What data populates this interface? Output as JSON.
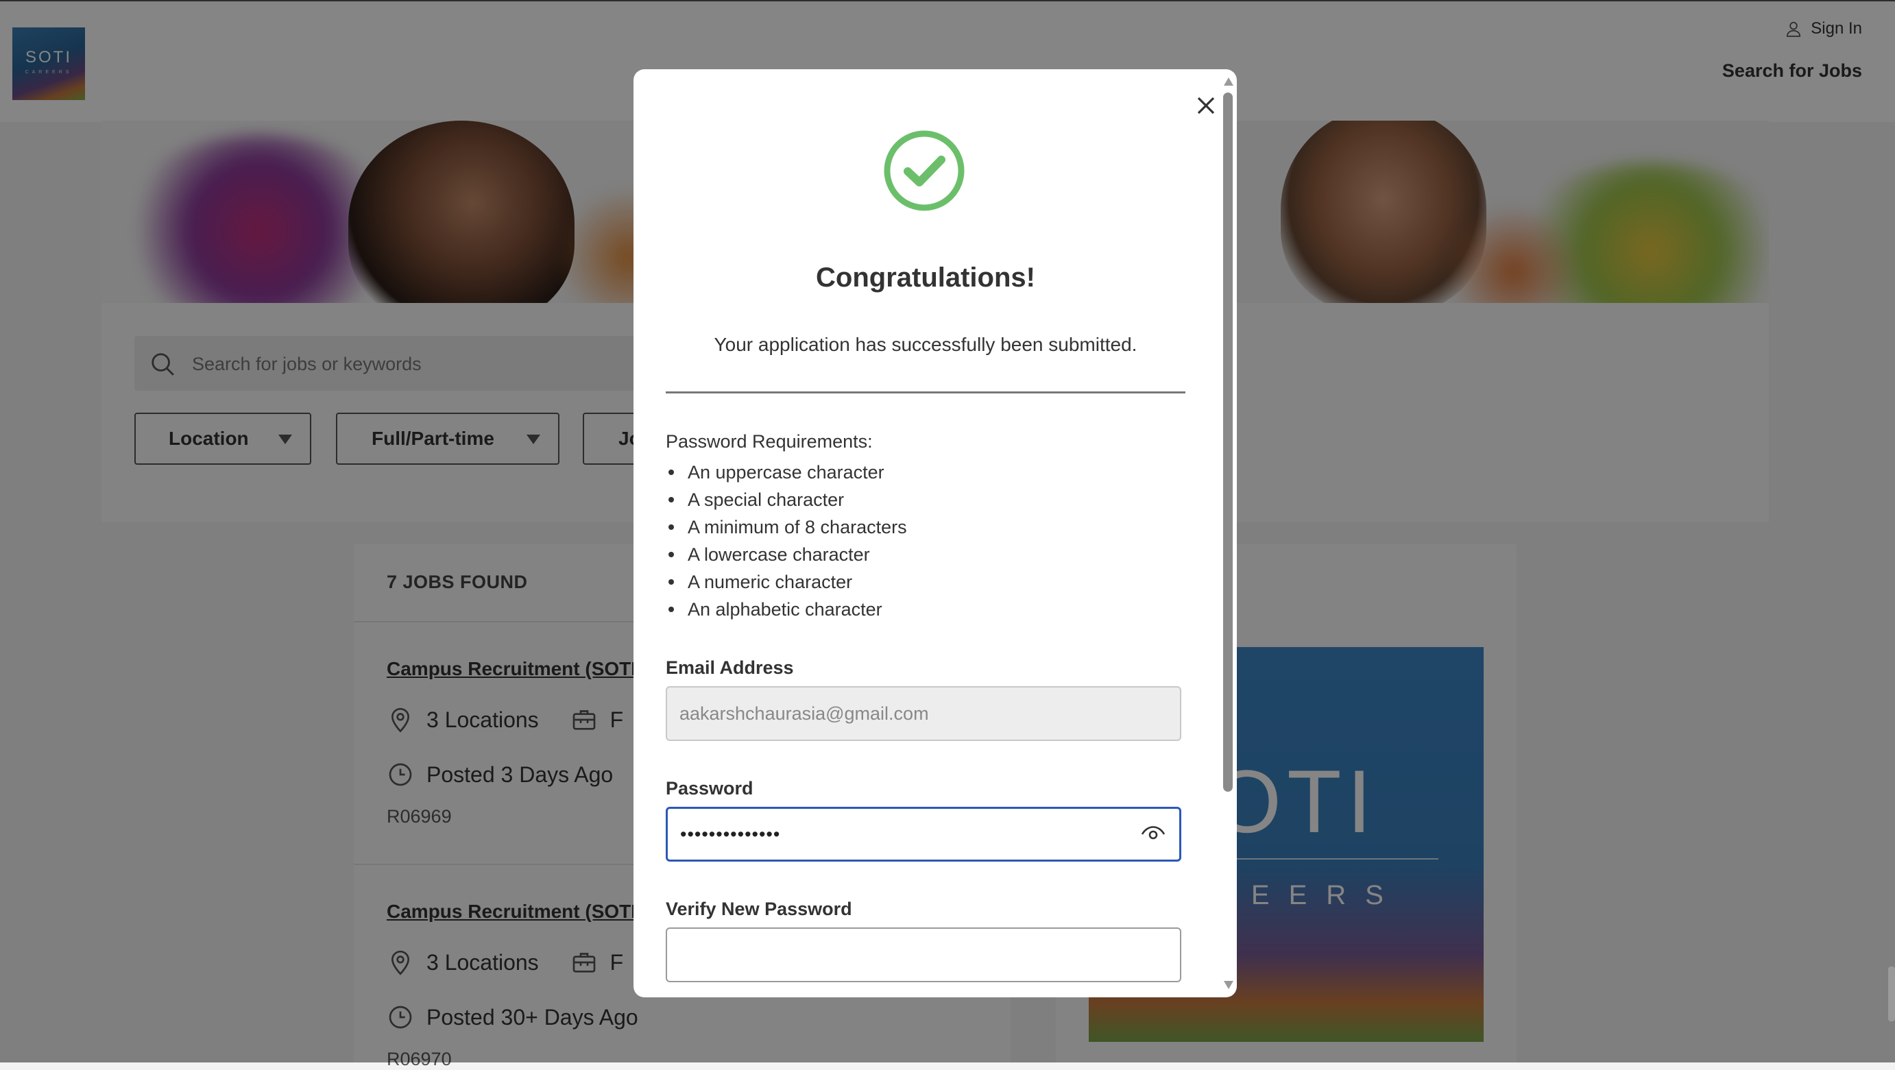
{
  "header": {
    "logo_text": "SOTI",
    "logo_subtext": "CAREERS",
    "sign_in_label": "Sign In",
    "search_jobs_label": "Search for Jobs"
  },
  "filters": {
    "search_placeholder": "Search for jobs or keywords",
    "location_label": "Location",
    "fulltime_label": "Full/Part-time",
    "third_label": "Jo"
  },
  "results": {
    "count_label": "7 JOBS FOUND",
    "jobs": [
      {
        "title": "Campus Recruitment (SOTI",
        "locations": "3 Locations",
        "type_initial": "F",
        "posted": "Posted 3 Days Ago",
        "id": "R06969"
      },
      {
        "title": "Campus Recruitment (SOTI",
        "locations": "3 Locations",
        "type_initial": "F",
        "posted": "Posted 30+ Days Ago",
        "id": "R06970"
      }
    ]
  },
  "side_banner": {
    "big_text": "OTI",
    "small_text": "REERS"
  },
  "modal": {
    "title": "Congratulations!",
    "message": "Your application has successfully been submitted.",
    "requirements_heading": "Password Requirements:",
    "requirements": [
      "An uppercase character",
      "A special character",
      "A minimum of 8 characters",
      "A lowercase character",
      "A numeric character",
      "An alphabetic character"
    ],
    "email_label": "Email Address",
    "email_value": "aakarshchaurasia@gmail.com",
    "password_label": "Password",
    "password_value": "••••••••••••••",
    "verify_label": "Verify New Password",
    "verify_value": ""
  },
  "colors": {
    "success_green": "#6cbf6a",
    "focus_blue": "#2b58b8"
  }
}
